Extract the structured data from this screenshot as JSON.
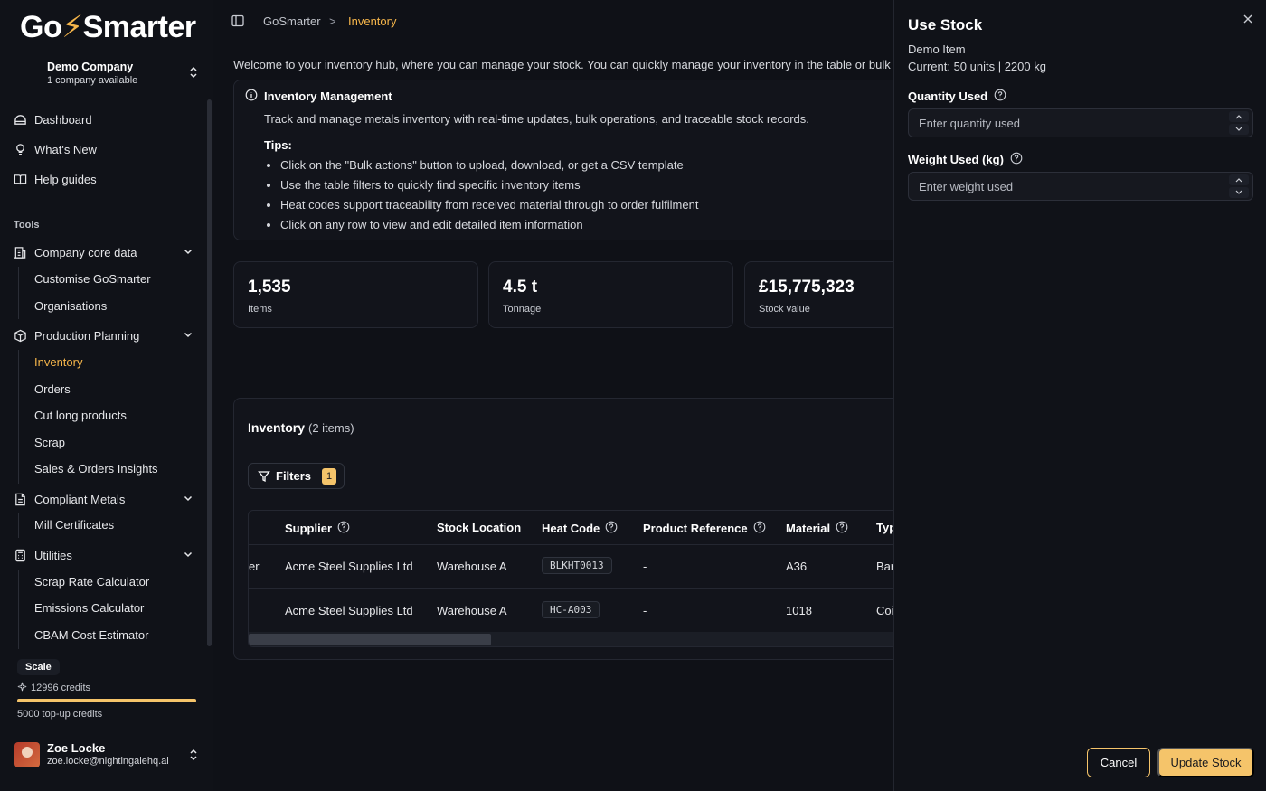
{
  "sidebar": {
    "logo_left": "Go",
    "logo_bolt": "⚡",
    "logo_right": "Smarter",
    "company_name": "Demo Company",
    "company_sub": "1 company available",
    "nav": {
      "dashboard": "Dashboard",
      "whats_new": "What's New",
      "help": "Help guides"
    },
    "tools_label": "Tools",
    "groups": {
      "company_core": "Company core data",
      "production": "Production Planning",
      "compliant": "Compliant Metals",
      "utilities": "Utilities"
    },
    "sub": {
      "customise": "Customise GoSmarter",
      "organisations": "Organisations",
      "inventory": "Inventory",
      "orders": "Orders",
      "cut_long": "Cut long products",
      "scrap": "Scrap",
      "insights": "Sales & Orders Insights",
      "mill": "Mill Certificates",
      "scrap_rate": "Scrap Rate Calculator",
      "emissions": "Emissions Calculator",
      "cbam": "CBAM Cost Estimator"
    },
    "plan": "Scale",
    "credits": "12996 credits",
    "credits_fill": 1.0,
    "topup": "5000 top-up credits",
    "user_name": "Zoe Locke",
    "user_email": "zoe.locke@nightingalehq.ai"
  },
  "topbar": {
    "crumb_home": "GoSmarter",
    "crumb_sep": ">",
    "crumb_current": "Inventory"
  },
  "main": {
    "welcome": "Welcome to your inventory hub, where you can manage your stock. You can quickly manage your inventory in the table or bulk up",
    "info_title": "Inventory Management",
    "info_desc": "Track and manage metals inventory with real-time updates, bulk operations, and traceable stock records.",
    "tips_label": "Tips:",
    "tips": [
      "Click on the \"Bulk actions\" button to upload, download, or get a CSV template",
      "Use the table filters to quickly find specific inventory items",
      "Heat codes support traceability from received material through to order fulfilment",
      "Click on any row to view and edit detailed item information"
    ],
    "stats": [
      {
        "value": "1,535",
        "label": "Items"
      },
      {
        "value": "4.5 t",
        "label": "Tonnage"
      },
      {
        "value": "£15,775,323",
        "label": "Stock value"
      }
    ],
    "table_title": "Inventory",
    "table_count": "(2 items)",
    "filters_label": "Filters",
    "filters_count": "1",
    "columns": {
      "supplier": "Supplier",
      "location": "Stock Location",
      "heat": "Heat Code",
      "product": "Product Reference",
      "material": "Material",
      "type": "Typ"
    },
    "rows": [
      {
        "prefix": "er",
        "supplier": "Acme Steel Supplies Ltd",
        "location": "Warehouse A",
        "heat": "BLKHT0013",
        "product": "-",
        "material": "A36",
        "type": "Bar"
      },
      {
        "prefix": "",
        "supplier": "Acme Steel Supplies Ltd",
        "location": "Warehouse A",
        "heat": "HC-A003",
        "product": "-",
        "material": "1018",
        "type": "Coil"
      }
    ]
  },
  "drawer": {
    "title": "Use Stock",
    "item": "Demo Item",
    "current": "Current: 50 units | 2200 kg",
    "qty_label": "Quantity Used",
    "qty_placeholder": "Enter quantity used",
    "weight_label": "Weight Used (kg)",
    "weight_placeholder": "Enter weight used",
    "cancel": "Cancel",
    "update": "Update Stock"
  },
  "colors": {
    "accent": "#f5c46a",
    "active_text": "#f5b54a",
    "background": "#0f1117"
  }
}
